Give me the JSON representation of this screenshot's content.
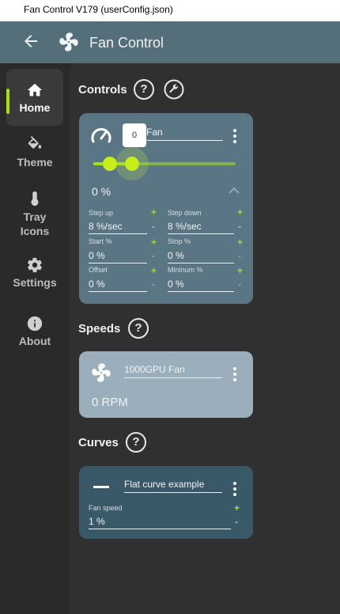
{
  "window": {
    "title": "Fan Control V179 (userConfig.json)"
  },
  "appbar": {
    "title": "Fan Control",
    "back_icon": "arrow-left-icon",
    "logo_icon": "fan-icon"
  },
  "sidebar": {
    "items": [
      {
        "label": "Home",
        "icon": "home-icon",
        "active": true
      },
      {
        "label": "Theme",
        "icon": "paint-bucket-icon"
      },
      {
        "label": "Tray\nIcons",
        "icon": "thermometer-icon"
      },
      {
        "label": "Settings",
        "icon": "gear-icon"
      },
      {
        "label": "About",
        "icon": "info-icon"
      }
    ],
    "accent": "#a6e01c"
  },
  "sections": {
    "controls": "Controls",
    "speeds": "Speeds",
    "curves": "Curves",
    "help_glyph": "?"
  },
  "control_card": {
    "name": "Fan",
    "slider_tooltip": "0",
    "slider_value": 0,
    "value": "0 %",
    "fields": [
      {
        "label": "Step up",
        "value": "8 %/sec"
      },
      {
        "label": "Step down",
        "value": "8 %/sec"
      },
      {
        "label": "Start %",
        "value": "0 %"
      },
      {
        "label": "Stop %",
        "value": "0 %"
      },
      {
        "label": "Offset",
        "value": "0 %"
      },
      {
        "label": "Mininum %",
        "value": "0 %"
      }
    ],
    "plus": "+",
    "minus": "-"
  },
  "speed_card": {
    "name": "1000GPU Fan",
    "value": "0 RPM"
  },
  "curve_card": {
    "name": "Flat curve example",
    "field_label": "Fan speed",
    "field_value": "1 %",
    "plus": "+",
    "minus": "-"
  }
}
